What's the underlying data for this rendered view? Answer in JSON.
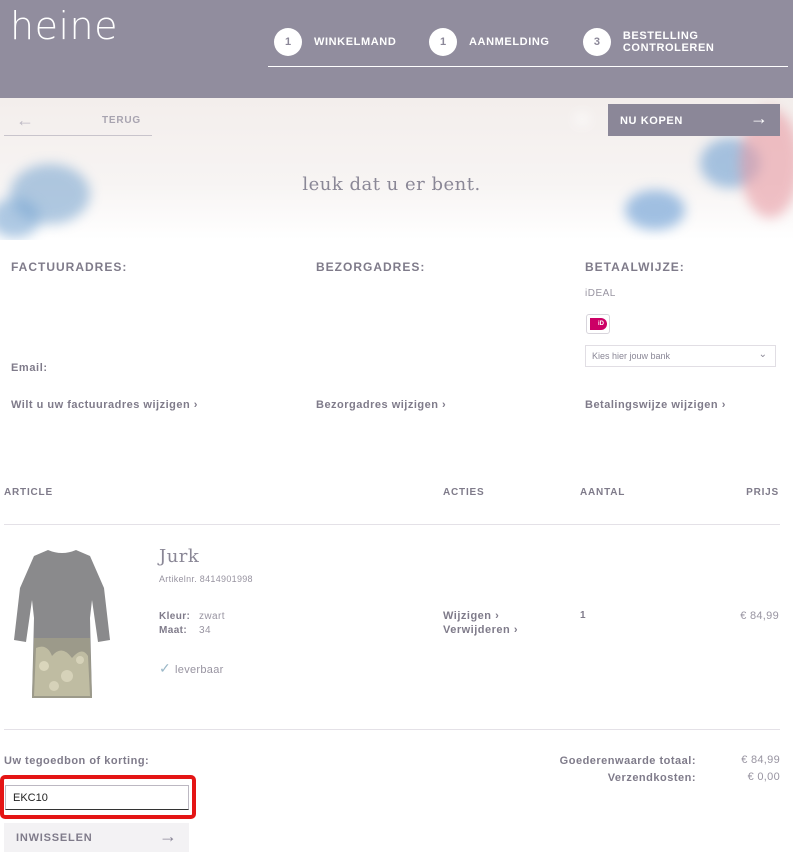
{
  "brand": {
    "logo": "heine"
  },
  "steps": [
    {
      "num": "1",
      "label": "WINKELMAND"
    },
    {
      "num": "1",
      "label": "AANMELDING"
    },
    {
      "num": "3",
      "label": "BESTELLING CONTROLEREN"
    }
  ],
  "nav": {
    "back_label": "TERUG",
    "buy_label": "NU KOPEN"
  },
  "banner": {
    "tagline": "leuk dat u er bent."
  },
  "sections": {
    "billing_title": "FACTUURADRES:",
    "delivery_title": "BEZORGADRES:",
    "payment_title": "BETAALWIJZE:",
    "payment_method": "iDEAL",
    "bank_select_value": "Kies hier jouw bank",
    "email_label": "Email:",
    "billing_link": "Wilt u uw factuuradres wijzigen",
    "delivery_link": "Bezorgadres wijzigen",
    "payment_link": "Betalingswijze wijzigen"
  },
  "table": {
    "headers": {
      "article": "ARTICLE",
      "actions": "ACTIES",
      "quantity": "AANTAL",
      "price": "PRIJS"
    }
  },
  "product": {
    "name": "Jurk",
    "article_no": "Artikelnr. 8414901998",
    "color_label": "Kleur:",
    "color_value": "zwart",
    "size_label": "Maat:",
    "size_value": "34",
    "availability": "leverbaar",
    "edit_link": "Wijzigen",
    "remove_link": "Verwijderen",
    "quantity": "1",
    "price": "€ 84,99"
  },
  "voucher": {
    "label": "Uw tegoedbon of korting:",
    "value": "EKC10",
    "redeem_label": "INWISSELEN"
  },
  "totals": {
    "goods_label": "Goederenwaarde totaal:",
    "goods_value": "€ 84,99",
    "shipping_label": "Verzendkosten:",
    "shipping_value": "€ 0,00"
  },
  "colors": {
    "header_bg": "#918d9e",
    "accent": "#8b8798",
    "highlight": "#e41515",
    "ideal": "#cc0066"
  }
}
